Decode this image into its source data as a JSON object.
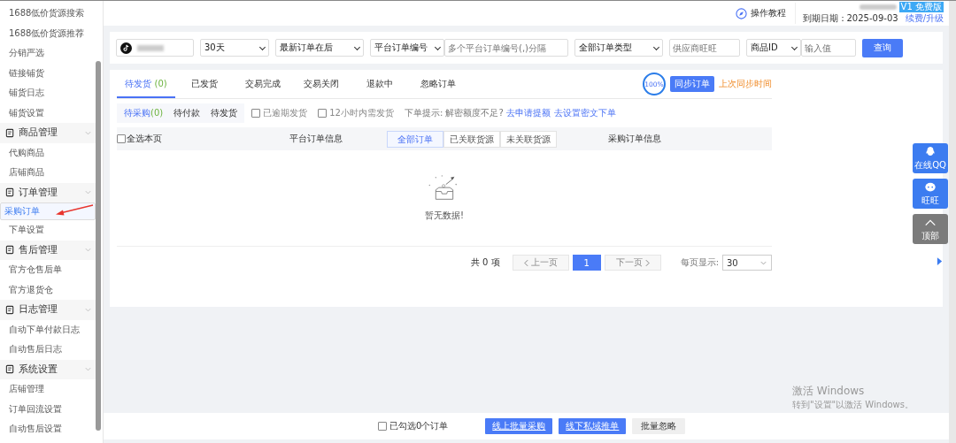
{
  "sidebar": {
    "items": [
      {
        "label": "1688低价货源搜索",
        "selected": false
      },
      {
        "label": "1688低价货源推荐",
        "selected": false
      },
      {
        "label": "分销严选",
        "selected": false
      },
      {
        "label": "链接铺货",
        "selected": false
      },
      {
        "label": "铺货日志",
        "selected": false
      },
      {
        "label": "铺货设置",
        "selected": false
      }
    ],
    "groups": [
      {
        "label": "商品管理",
        "expanded": true,
        "items": [
          {
            "label": "代购商品",
            "selected": false
          },
          {
            "label": "店铺商品",
            "selected": false
          }
        ]
      },
      {
        "label": "订单管理",
        "expanded": true,
        "items": [
          {
            "label": "采购订单",
            "selected": true
          },
          {
            "label": "下单设置",
            "selected": false
          }
        ]
      },
      {
        "label": "售后管理",
        "expanded": true,
        "items": [
          {
            "label": "官方仓售后单",
            "selected": false
          },
          {
            "label": "官方退货仓",
            "selected": false
          }
        ]
      },
      {
        "label": "日志管理",
        "expanded": true,
        "items": [
          {
            "label": "自动下单付款日志",
            "selected": false
          },
          {
            "label": "自动售后日志",
            "selected": false
          }
        ]
      },
      {
        "label": "系统设置",
        "expanded": true,
        "items": [
          {
            "label": "店铺管理",
            "selected": false
          },
          {
            "label": "订单回流设置",
            "selected": false
          },
          {
            "label": "自动售后设置",
            "selected": false
          }
        ]
      }
    ]
  },
  "header": {
    "help_link": "操作教程",
    "plan_badge": "V1 免费版",
    "expiry": "到期日期：2025-09-03",
    "upgrade_link": "续费/升级"
  },
  "filters": {
    "period": "30天",
    "sort": "最新订单在后",
    "order_field": "平台订单编号",
    "order_placeholder": "多个平台订单编号(,)分隔",
    "order_type": "全部订单类型",
    "supplier_placeholder": "供应商旺旺",
    "product_field": "商品ID",
    "product_placeholder": "输入值",
    "query_button": "查询"
  },
  "tabs": [
    {
      "label": "待发货",
      "count": "(0)",
      "selected": true
    },
    {
      "label": "已发货",
      "selected": false
    },
    {
      "label": "交易完成",
      "selected": false
    },
    {
      "label": "交易关闭",
      "selected": false
    },
    {
      "label": "退款中",
      "selected": false
    },
    {
      "label": "忽略订单",
      "selected": false
    }
  ],
  "sync": {
    "progress": "100%",
    "button": "同步订单",
    "last_sync": "上次同步时间"
  },
  "sub_tabs": [
    {
      "label": "待采购",
      "count": "(0)",
      "selected": true
    },
    {
      "label": "待付款",
      "selected": false
    },
    {
      "label": "待发货",
      "selected": false
    }
  ],
  "options": [
    {
      "label": "已逾期发货",
      "checked": false
    },
    {
      "label": "12小时内需发货",
      "checked": false
    }
  ],
  "hint": {
    "text": "下单提示: 解密额度不足?",
    "links": [
      "去申请提额",
      "去设置密文下单"
    ]
  },
  "table": {
    "select_all": {
      "label": "全选本页",
      "checked": false
    },
    "column_1": "平台订单信息",
    "segments": [
      {
        "label": "全部订单",
        "selected": true
      },
      {
        "label": "已关联货源",
        "selected": false
      },
      {
        "label": "未关联货源",
        "selected": false
      }
    ],
    "column_2": "采购订单信息",
    "empty": "暂无数据!"
  },
  "pagination": {
    "total": "共 0 项",
    "prev": {
      "label": "上一页",
      "disabled": true
    },
    "pages": [
      {
        "label": "1",
        "selected": true
      }
    ],
    "next": {
      "label": "下一页",
      "disabled": true
    },
    "per_page_label": "每页显示:",
    "per_page": "30"
  },
  "bottom_bar": {
    "selected": {
      "label": "已勾选0个订单",
      "checked": false
    },
    "buttons": [
      {
        "label": "线上批量采购",
        "kind": "primary"
      },
      {
        "label": "线下私域推单",
        "kind": "primary"
      },
      {
        "label": "批量忽略",
        "kind": "plain"
      }
    ]
  },
  "float_buttons": [
    {
      "label": "在线QQ",
      "kind": "qq"
    },
    {
      "label": "旺旺",
      "kind": "chat"
    },
    {
      "label": "顶部",
      "kind": "top"
    }
  ],
  "os_notice": {
    "title": "激活 Windows",
    "text": "转到\"设置\"以激活 Windows。"
  }
}
